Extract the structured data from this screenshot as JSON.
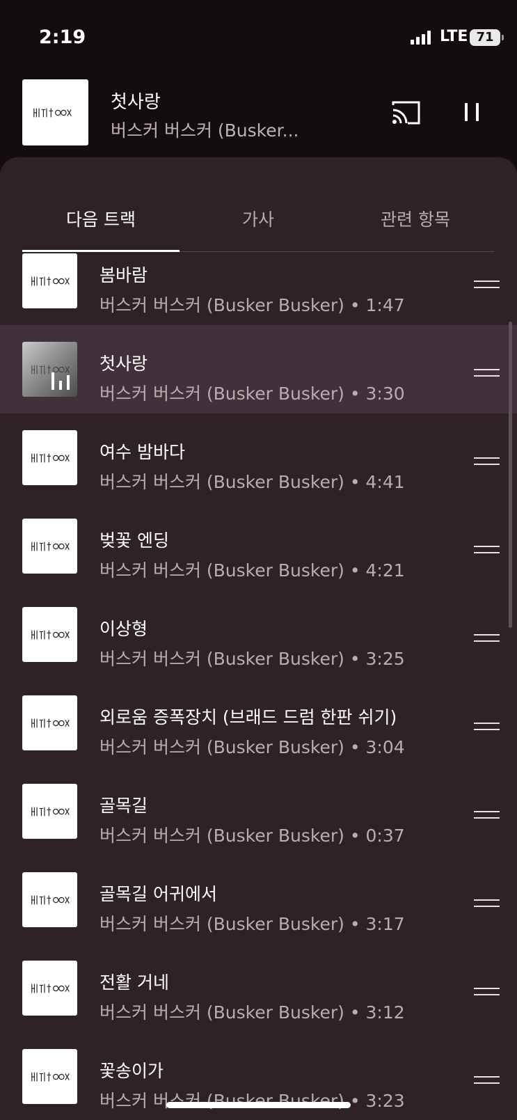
{
  "status_bar": {
    "time": "2:19",
    "network": "LTE",
    "battery": "71"
  },
  "now_playing": {
    "title": "첫사랑",
    "artist": "버스커 버스커 (Busker..."
  },
  "tabs": [
    {
      "label": "다음 트랙",
      "active": true
    },
    {
      "label": "가사",
      "active": false
    },
    {
      "label": "관련 항목",
      "active": false
    }
  ],
  "queue": [
    {
      "title": "봄바람",
      "subtitle": "버스커 버스커 (Busker Busker) • 1:47",
      "current": false
    },
    {
      "title": "첫사랑",
      "subtitle": "버스커 버스커 (Busker Busker) • 3:30",
      "current": true
    },
    {
      "title": "여수 밤바다",
      "subtitle": "버스커 버스커 (Busker Busker) • 4:41",
      "current": false
    },
    {
      "title": "벚꽃 엔딩",
      "subtitle": "버스커 버스커 (Busker Busker) • 4:21",
      "current": false
    },
    {
      "title": "이상형",
      "subtitle": "버스커 버스커 (Busker Busker) • 3:25",
      "current": false
    },
    {
      "title": "외로움 증폭장치 (브래드 드럼 한판 쉬기)",
      "subtitle": "버스커 버스커 (Busker Busker) • 3:04",
      "current": false
    },
    {
      "title": "골목길",
      "subtitle": "버스커 버스커 (Busker Busker) • 0:37",
      "current": false
    },
    {
      "title": "골목길 어귀에서",
      "subtitle": "버스커 버스커 (Busker Busker) • 3:17",
      "current": false
    },
    {
      "title": "전활 거네",
      "subtitle": "버스커 버스커 (Busker Busker) • 3:12",
      "current": false
    },
    {
      "title": "꽃송이가",
      "subtitle": "버스커 버스커 (Busker Busker) • 3:23",
      "current": false
    }
  ],
  "colors": {
    "background": "#140d10",
    "sheet": "#2f2128",
    "current_row": "#42303a",
    "secondary_text": "#b7aeb1"
  },
  "icons": {
    "cast": "cast-icon",
    "pause": "pause-icon",
    "drag": "drag-handle-icon",
    "equalizer": "equalizer-icon"
  }
}
